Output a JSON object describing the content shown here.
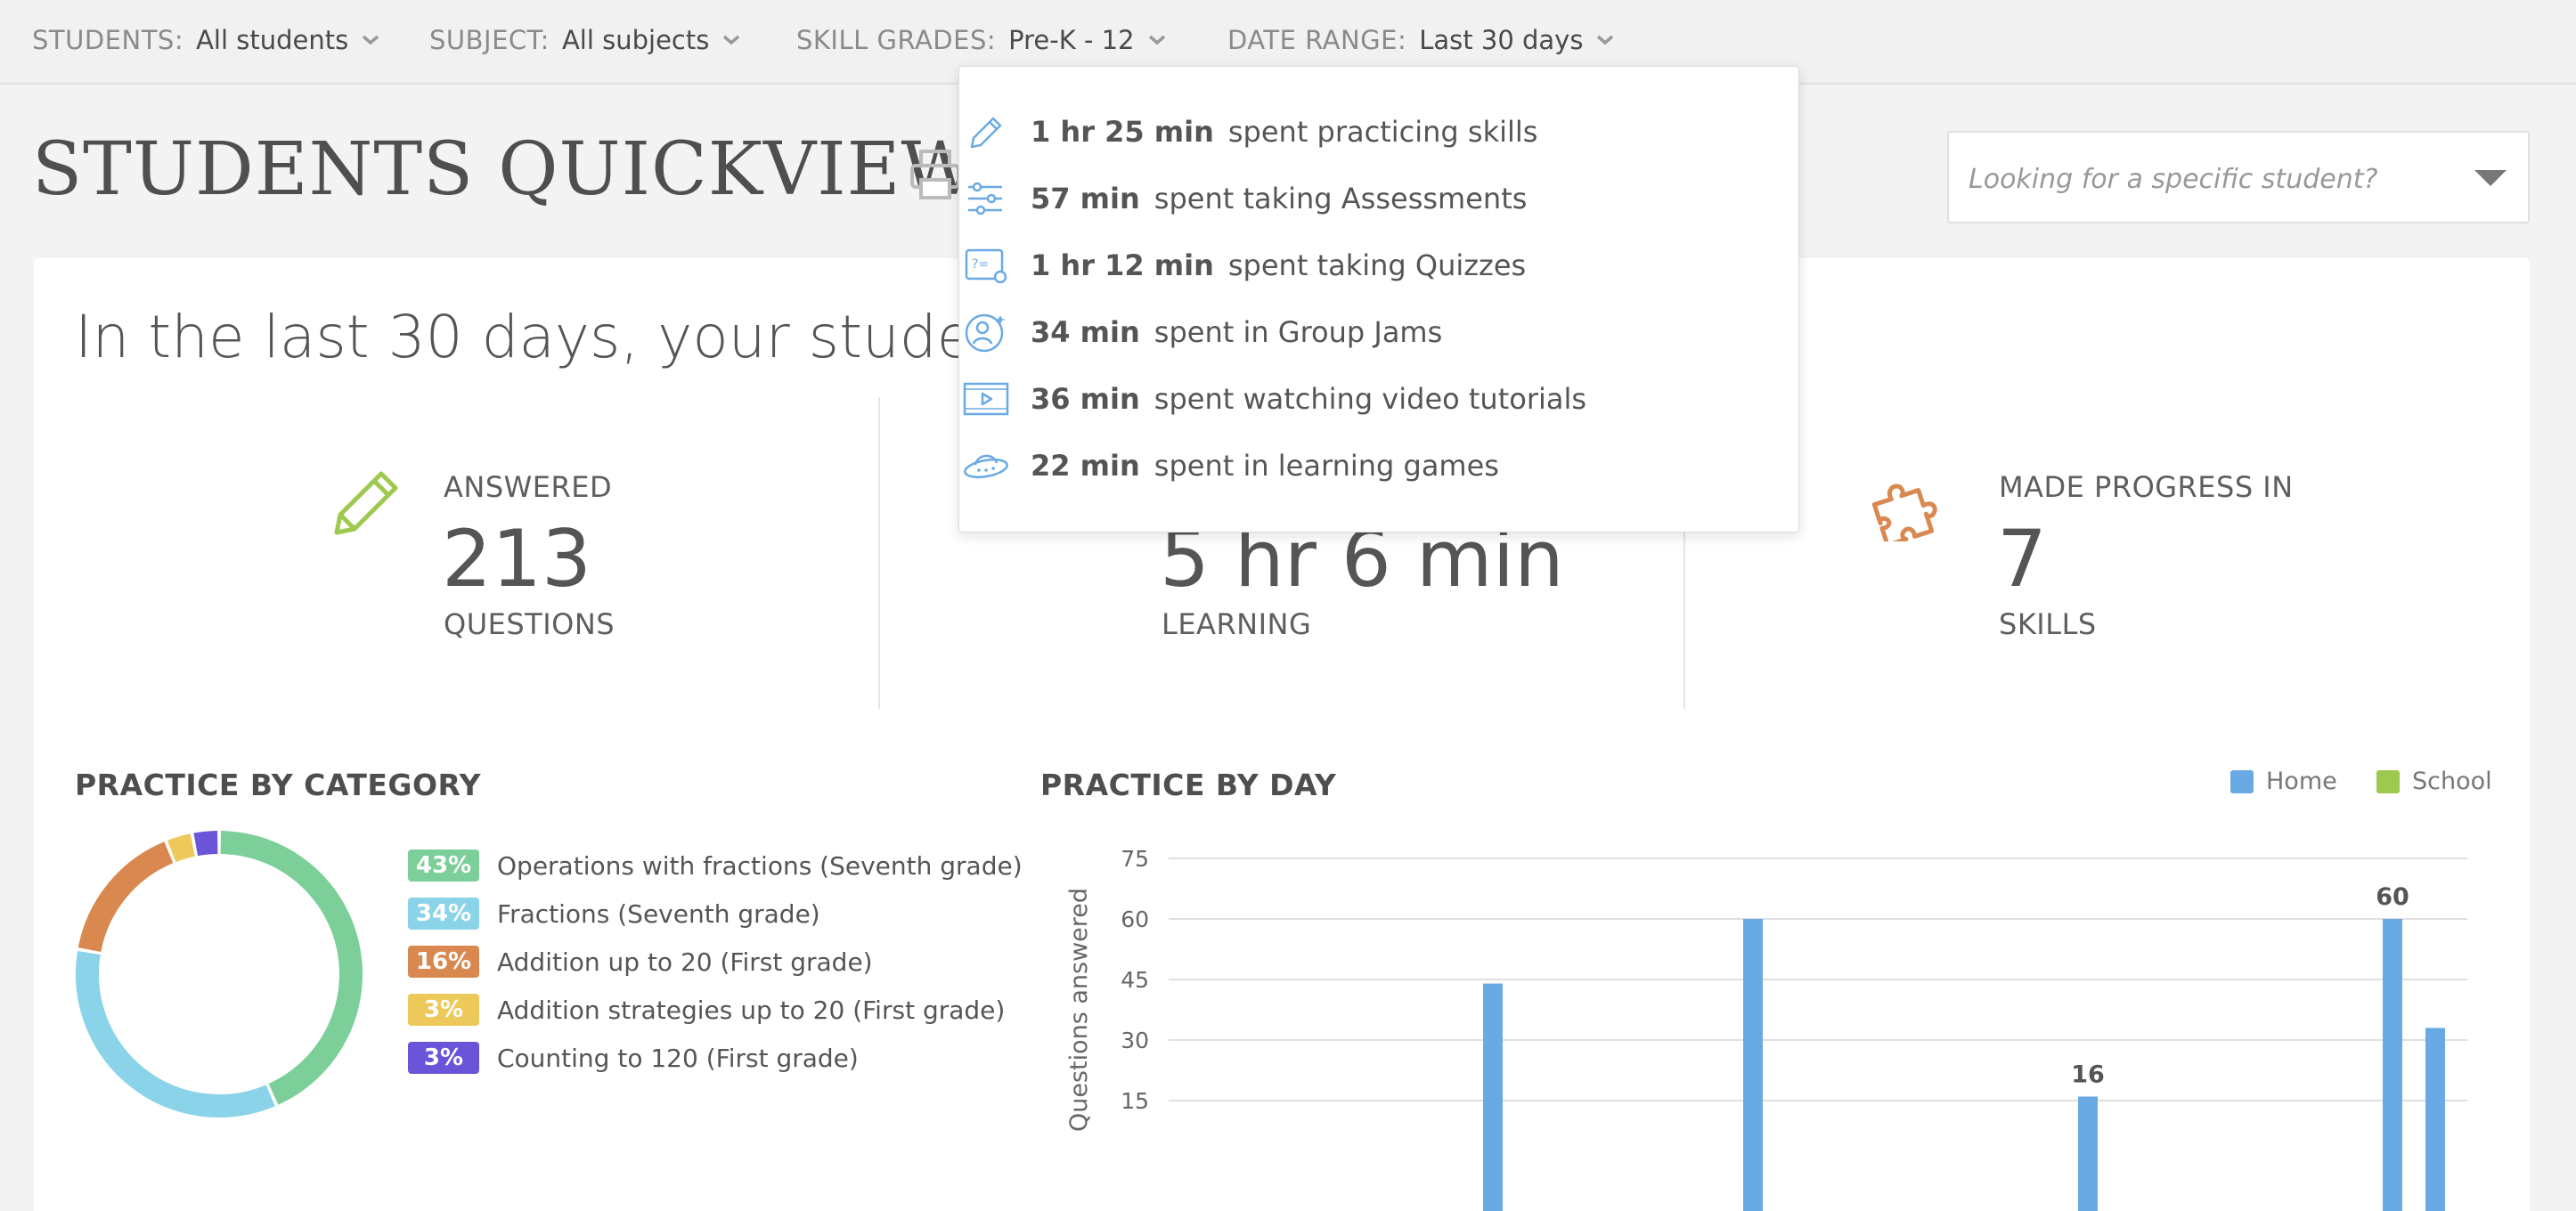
{
  "filters": [
    {
      "label": "STUDENTS:",
      "value": "All students"
    },
    {
      "label": "SUBJECT:",
      "value": "All subjects"
    },
    {
      "label": "SKILL GRADES:",
      "value": "Pre-K - 12"
    },
    {
      "label": "DATE RANGE:",
      "value": "Last 30 days"
    }
  ],
  "title": "STUDENTS QUICKVIEW",
  "search": {
    "placeholder": "Looking for a specific student?"
  },
  "headline": "In the last 30 days, your students l",
  "stats": [
    {
      "top": "ANSWERED",
      "value": "213",
      "bottom": "QUESTIONS"
    },
    {
      "top": "",
      "value": "5 hr 6 min",
      "bottom": "LEARNING"
    },
    {
      "top": "MADE PROGRESS IN",
      "value": "7",
      "bottom": "SKILLS"
    }
  ],
  "time_breakdown": [
    {
      "duration": "1 hr 25 min",
      "activity": "spent practicing skills",
      "icon": "pencil-icon"
    },
    {
      "duration": "57 min",
      "activity": "spent taking Assessments",
      "icon": "sliders-icon"
    },
    {
      "duration": "1 hr 12 min",
      "activity": "spent taking Quizzes",
      "icon": "quiz-icon"
    },
    {
      "duration": "34 min",
      "activity": "spent in Group Jams",
      "icon": "group-jam-icon"
    },
    {
      "duration": "36 min",
      "activity": "spent watching video tutorials",
      "icon": "video-icon"
    },
    {
      "duration": "22 min",
      "activity": "spent in learning games",
      "icon": "ufo-icon"
    }
  ],
  "category_section": {
    "title": "PRACTICE BY CATEGORY"
  },
  "categories": [
    {
      "pct_label": "43%",
      "pct": 43,
      "name": "Operations with fractions (Seventh grade)",
      "color": "#7ccf99"
    },
    {
      "pct_label": "34%",
      "pct": 34,
      "name": "Fractions (Seventh grade)",
      "color": "#8ad3e8"
    },
    {
      "pct_label": "16%",
      "pct": 16,
      "name": "Addition up to 20 (First grade)",
      "color": "#d98850"
    },
    {
      "pct_label": "3%",
      "pct": 3,
      "name": "Addition strategies up to 20 (First grade)",
      "color": "#edc85a"
    },
    {
      "pct_label": "3%",
      "pct": 3,
      "name": "Counting to 120 (First grade)",
      "color": "#6a55d8"
    }
  ],
  "day_section": {
    "title": "PRACTICE BY DAY",
    "legend_home": "Home",
    "legend_school": "School",
    "home_color": "#6aaae4",
    "school_color": "#9cc94e"
  },
  "chart_data": {
    "type": "bar",
    "title": "PRACTICE BY DAY",
    "ylabel": "Questions answered",
    "ylim": [
      0,
      75
    ],
    "yticks": [
      15,
      30,
      45,
      60,
      75
    ],
    "grid": true,
    "legend_placement": "top-right",
    "series": [
      {
        "name": "Home",
        "color": "#6aaae4",
        "values": [
          44,
          60,
          16,
          60,
          33
        ],
        "data_labels": [
          "",
          "",
          "16",
          "60",
          ""
        ]
      },
      {
        "name": "School",
        "color": "#9cc94e",
        "values": [
          0,
          0,
          0,
          0,
          0
        ]
      }
    ]
  }
}
